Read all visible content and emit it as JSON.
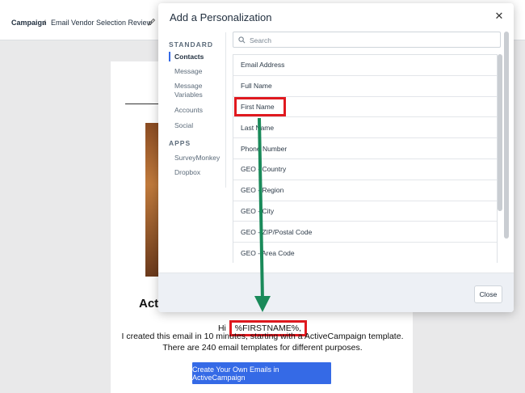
{
  "breadcrumb": {
    "root": "Campaign",
    "separator": "/",
    "page": "Email Vendor Selection Review"
  },
  "modal": {
    "title": "Add a Personalization",
    "sidebar": {
      "standard_label": "STANDARD",
      "standard_items": [
        "Contacts",
        "Message",
        "Message Variables",
        "Accounts",
        "Social"
      ],
      "apps_label": "APPS",
      "apps_items": [
        "SurveyMonkey",
        "Dropbox"
      ],
      "active": "Contacts"
    },
    "search": {
      "placeholder": "Search",
      "value": ""
    },
    "fields": [
      "Email Address",
      "Full Name",
      "First Name",
      "Last Name",
      "Phone Number",
      "GEO - Country",
      "GEO - Region",
      "GEO - City",
      "GEO - ZIP/Postal Code",
      "GEO - Area Code"
    ],
    "close_label": "Close"
  },
  "email": {
    "heading": "Acti",
    "greeting_prefix": "Hi",
    "token": "%FIRSTNAME%,",
    "line1": "I created this email in 10 minutes, starting with a ActiveCampaign template.",
    "line2": "There are 240 email templates for different purposes.",
    "cta": "Create Your Own Emails in ActiveCampaign"
  },
  "colors": {
    "accent": "#356ae6",
    "highlight": "#e0191f",
    "arrow": "#1a8a5a"
  }
}
